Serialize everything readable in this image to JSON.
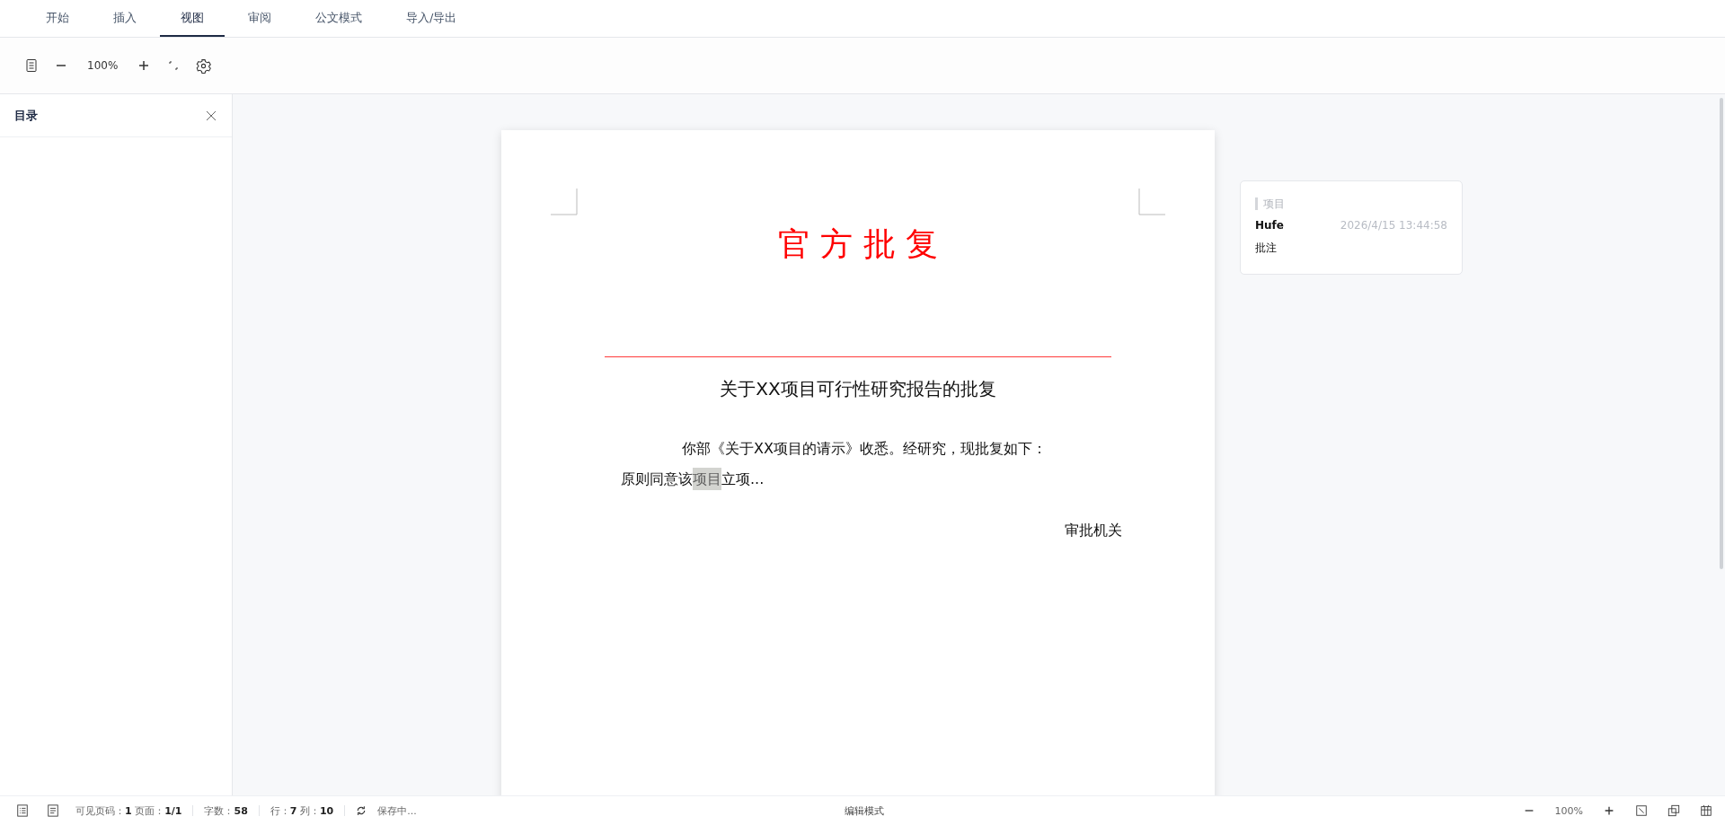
{
  "tabs": [
    {
      "label": "开始",
      "selected": false
    },
    {
      "label": "插入",
      "selected": false
    },
    {
      "label": "视图",
      "selected": true
    },
    {
      "label": "审阅",
      "selected": false
    },
    {
      "label": "公文模式",
      "selected": false
    },
    {
      "label": "导入/导出",
      "selected": false
    }
  ],
  "toolbar": {
    "zoom": "100%"
  },
  "sidebar": {
    "title": "目录"
  },
  "document": {
    "title": "官 方 批 复",
    "subtitle": "关于XX项目可行性研究报告的批复",
    "paragraph_1": "你部《关于XX项目的请示》收悉。经研究，现批复如下：",
    "paragraph_2": [
      {
        "text": "原则同意该",
        "highlighted": false
      },
      {
        "text": "项目",
        "highlighted": true
      },
      {
        "text": "立项...",
        "highlighted": false
      }
    ],
    "signature": "审批机关"
  },
  "comment": {
    "quote": "项目",
    "author": "Hufe",
    "time": "2026/4/15 13:44:58",
    "text": "批注"
  },
  "status_bar": {
    "items": [
      {
        "text": "可见页码：**1**  页面：**1/1**"
      },
      {
        "text": "字数：**58**"
      },
      {
        "text": "行：**7**  列：**10**"
      }
    ],
    "saving": "保存中...",
    "mode": "编辑模式",
    "zoom": "100%"
  }
}
